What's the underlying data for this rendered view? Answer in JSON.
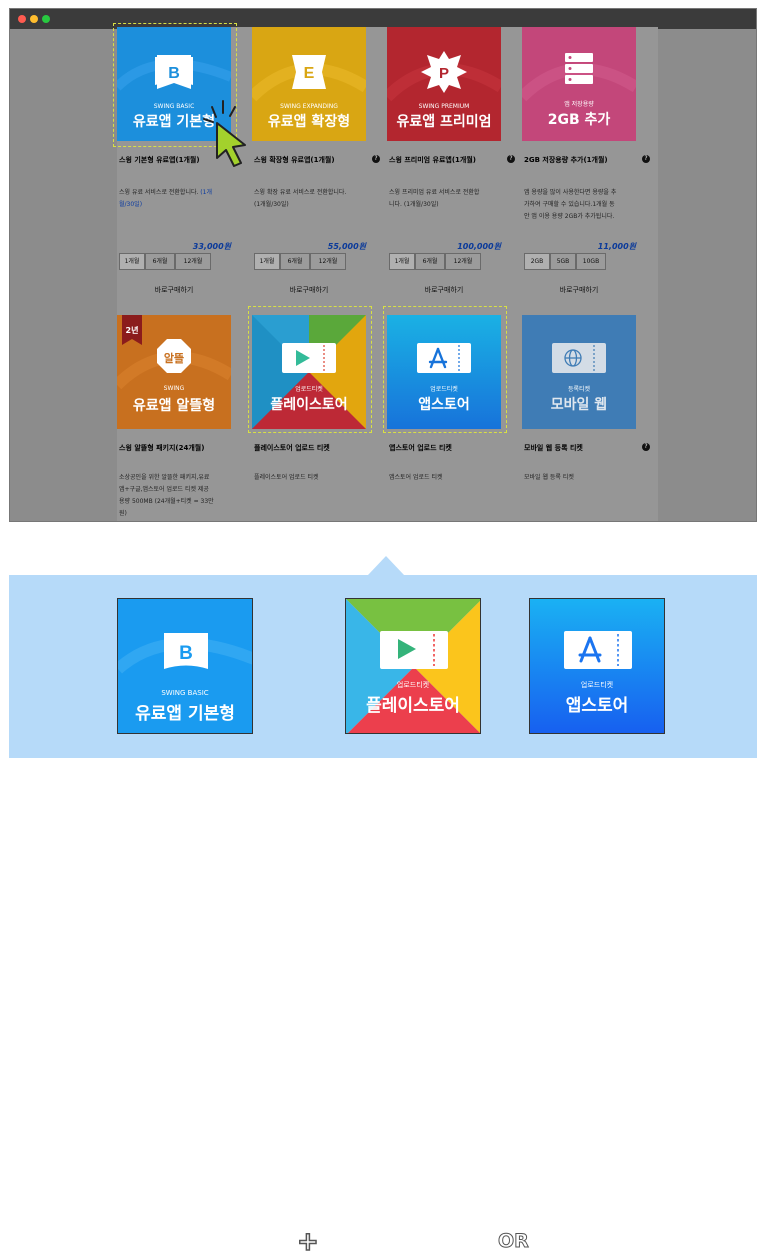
{
  "store": {
    "products": [
      {
        "brand": "SWING BASIC",
        "name": "유료앱 기본형",
        "letter": "B",
        "title": "스윙 기본형 유료앱(1개월)",
        "desc1": "스윙 유료 서비스로 전환합니다. ",
        "desc1_link": "(1개",
        "desc2": "월/30일)",
        "price": "33,000원",
        "options": [
          "1개월",
          "6개월",
          "12개월"
        ],
        "buy": "바로구매하기"
      },
      {
        "brand": "SWING EXPANDING",
        "name": "유료앱 확장형",
        "letter": "E",
        "title": "스윙 확장형 유료앱(1개월)",
        "desc1": "스윙 확장 유료 서비스로 전환합니다.",
        "desc2": "(1개월/30일)",
        "price": "55,000원",
        "options": [
          "1개월",
          "6개월",
          "12개월"
        ],
        "buy": "바로구매하기"
      },
      {
        "brand": "SWING PREMIUM",
        "name": "유료앱 프리미엄",
        "letter": "P",
        "title": "스윙 프리미엄 유료앱(1개월)",
        "desc1": "스윙 프리미엄 유료 서비스로 전환합",
        "desc2": "니다. (1개월/30일)",
        "price": "100,000원",
        "options": [
          "1개월",
          "6개월",
          "12개월"
        ],
        "buy": "바로구매하기"
      },
      {
        "brand": "앱 저장용량",
        "name": "2GB 추가",
        "title": "2GB 저장용량 추가(1개월)",
        "desc1": "앱 용량을 많이 사용한다면 용량을 추",
        "desc2": "가하여 구매할 수 있습니다.1개월 동",
        "desc3": "안 앱 이용 용량 2GB가 추가됩니다.",
        "price": "11,000원",
        "options": [
          "2GB",
          "5GB",
          "10GB"
        ],
        "buy": "바로구매하기"
      },
      {
        "ribbon": "2년",
        "badge": "알뜰",
        "brand": "SWING",
        "name": "유료앱 알뜰형",
        "title": "스윙 알뜰형 패키지(24개월)",
        "desc1": "소상공인을 위한 알뜰한 패키지,유료",
        "desc2": "앱+구글,앱스토어 업로드 티켓 제공",
        "desc3": "용량 500MB (24개월+티켓 = 33만",
        "desc4": "원)"
      },
      {
        "brand": "업로드티켓",
        "name": "플레이스토어",
        "title": "플레이스토어 업로드 티켓",
        "desc1": "플레이스토어 업로드 티켓"
      },
      {
        "brand": "업로드티켓",
        "name": "앱스토어",
        "title": "앱스토어 업로드 티켓",
        "desc1": "앱스토어 업로드 티켓"
      },
      {
        "brand": "등록티켓",
        "name": "모바일 웹",
        "title": "모바일 웹 등록 티켓",
        "desc1": "모바일 웹 등록 티켓"
      }
    ],
    "help_glyph": "?"
  },
  "bundle": {
    "basic": {
      "brand": "SWING BASIC",
      "name": "유료앱 기본형",
      "letter": "B"
    },
    "plus": "+",
    "play": {
      "brand": "업로드티켓",
      "name": "플레이스토어"
    },
    "or": "OR",
    "appstore": {
      "brand": "업로드티켓",
      "name": "앱스토어"
    }
  },
  "colors": {
    "basic": "#1a9bf0",
    "expanding": "#f5c518",
    "premium": "#d82c38",
    "storage": "#f05a92",
    "saver": "#f08a25",
    "appstore": "#1689ff",
    "mobileweb": "#3d8fd6",
    "highlight": "#d8e043",
    "cursor": "#a3d12c",
    "panel": "#b6daf9"
  },
  "icons": [
    "cursor-arrow-icon",
    "play-triangle-icon",
    "appstore-a-icon",
    "globe-icon",
    "server-icon",
    "help-icon"
  ]
}
